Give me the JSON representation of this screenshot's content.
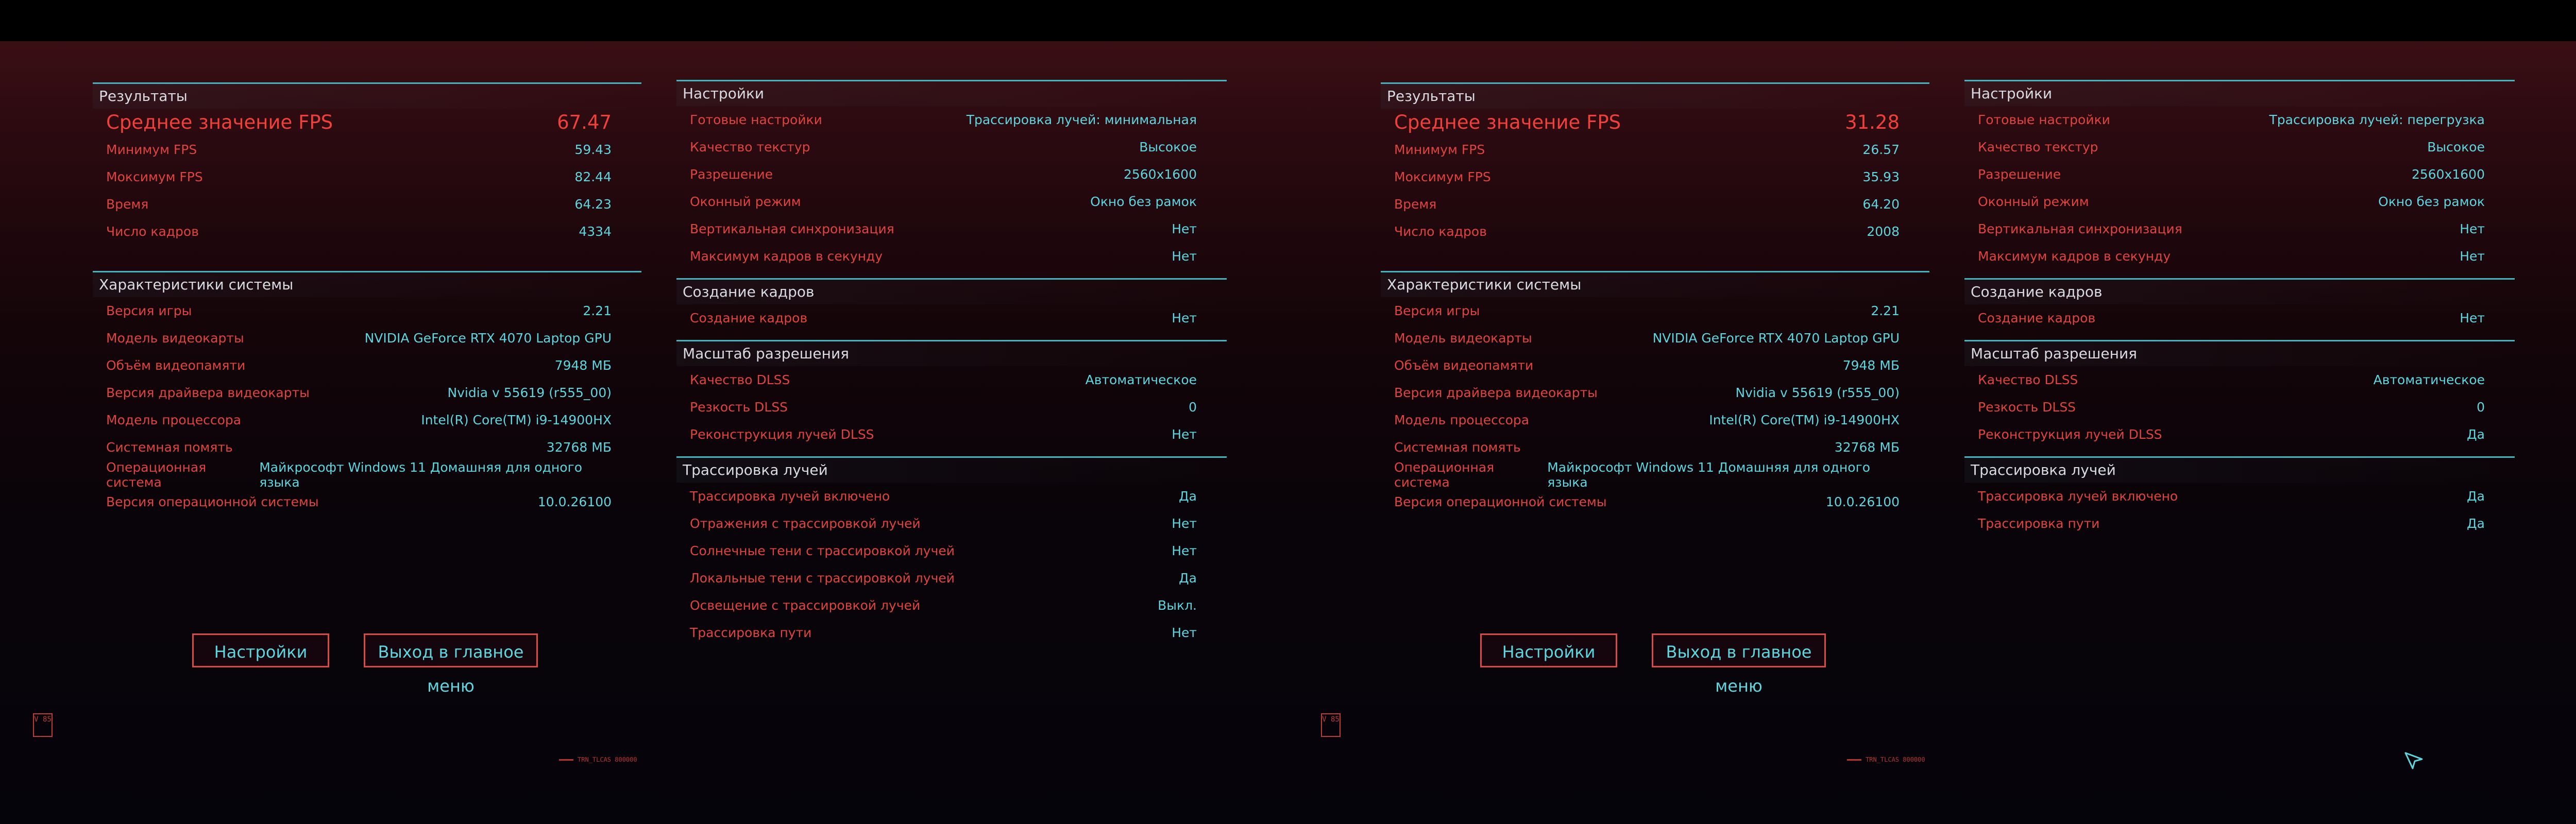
{
  "screens": [
    {
      "results": {
        "title": "Результаты",
        "avg_label": "Среднее значение FPS",
        "avg_value": "67.47",
        "rows": [
          {
            "k": "Минимум FPS",
            "v": "59.43"
          },
          {
            "k": "Моксимум FPS",
            "v": "82.44"
          },
          {
            "k": "Время",
            "v": "64.23"
          },
          {
            "k": "Число кадров",
            "v": "4334"
          }
        ]
      },
      "system": {
        "title": "Характеристики системы",
        "rows": [
          {
            "k": "Версия игры",
            "v": "2.21"
          },
          {
            "k": "Модель видеокарты",
            "v": "NVIDIA GeForce RTX 4070 Laptop GPU"
          },
          {
            "k": "Объём видеопамяти",
            "v": "7948 МБ"
          },
          {
            "k": "Версия драйвера видеокарты",
            "v": "Nvidia v 55619 (r555_00)"
          },
          {
            "k": "Модель процессора",
            "v": "Intel(R) Core(TM) i9-14900HX"
          },
          {
            "k": "Системная помять",
            "v": "32768 МБ"
          },
          {
            "k": "Операционная система",
            "v": "Майкрософт Windows 11 Домашняя для одного языка"
          },
          {
            "k": "Версия операционной системы",
            "v": "10.0.26100"
          }
        ]
      },
      "settings": {
        "title": "Настройки",
        "rows": [
          {
            "k": "Готовые настройки",
            "v": "Трассировка лучей: минимальная"
          },
          {
            "k": "Качество текстур",
            "v": "Высокое"
          },
          {
            "k": "Разрешение",
            "v": "2560x1600"
          },
          {
            "k": "Оконный режим",
            "v": "Окно без рамок"
          },
          {
            "k": "Вертикальная синхронизация",
            "v": "Нет"
          },
          {
            "k": "Максимум кадров в секунду",
            "v": "Нет"
          }
        ]
      },
      "frames": {
        "title": "Создание кадров",
        "rows": [
          {
            "k": "Создание кадров",
            "v": "Нет"
          }
        ]
      },
      "scale": {
        "title": "Масштаб разрешения",
        "rows": [
          {
            "k": "Качество DLSS",
            "v": "Автоматическое"
          },
          {
            "k": "Резкость DLSS",
            "v": "0"
          },
          {
            "k": "Реконструкция лучей DLSS",
            "v": "Нет"
          }
        ]
      },
      "rt": {
        "title": "Трассировка лучей",
        "rows": [
          {
            "k": "Трассировка лучей включено",
            "v": "Да"
          },
          {
            "k": "Отражения с трассировкой лучей",
            "v": "Нет"
          },
          {
            "k": "Солнечные тени с трассировкой лучей",
            "v": "Нет"
          },
          {
            "k": "Локальные тени с трассировкой лучей",
            "v": "Да"
          },
          {
            "k": "Освещение с трассировкой лучей",
            "v": "Выкл."
          },
          {
            "k": "Трассировка пути",
            "v": "Нет"
          }
        ]
      },
      "buttons": {
        "settings": "Настройки",
        "exit": "Выход в главное меню"
      }
    },
    {
      "results": {
        "title": "Результаты",
        "avg_label": "Среднее значение FPS",
        "avg_value": "31.28",
        "rows": [
          {
            "k": "Минимум FPS",
            "v": "26.57"
          },
          {
            "k": "Моксимум FPS",
            "v": "35.93"
          },
          {
            "k": "Время",
            "v": "64.20"
          },
          {
            "k": "Число кадров",
            "v": "2008"
          }
        ]
      },
      "system": {
        "title": "Характеристики системы",
        "rows": [
          {
            "k": "Версия игры",
            "v": "2.21"
          },
          {
            "k": "Модель видеокарты",
            "v": "NVIDIA GeForce RTX 4070 Laptop GPU"
          },
          {
            "k": "Объём видеопамяти",
            "v": "7948 МБ"
          },
          {
            "k": "Версия драйвера видеокарты",
            "v": "Nvidia v 55619 (r555_00)"
          },
          {
            "k": "Модель процессора",
            "v": "Intel(R) Core(TM) i9-14900HX"
          },
          {
            "k": "Системная помять",
            "v": "32768 МБ"
          },
          {
            "k": "Операционная система",
            "v": "Майкрософт Windows 11 Домашняя для одного языка"
          },
          {
            "k": "Версия операционной системы",
            "v": "10.0.26100"
          }
        ]
      },
      "settings": {
        "title": "Настройки",
        "rows": [
          {
            "k": "Готовые настройки",
            "v": "Трассировка лучей: перегрузка"
          },
          {
            "k": "Качество текстур",
            "v": "Высокое"
          },
          {
            "k": "Разрешение",
            "v": "2560x1600"
          },
          {
            "k": "Оконный режим",
            "v": "Окно без рамок"
          },
          {
            "k": "Вертикальная синхронизация",
            "v": "Нет"
          },
          {
            "k": "Максимум кадров в секунду",
            "v": "Нет"
          }
        ]
      },
      "frames": {
        "title": "Создание кадров",
        "rows": [
          {
            "k": "Создание кадров",
            "v": "Нет"
          }
        ]
      },
      "scale": {
        "title": "Масштаб разрешения",
        "rows": [
          {
            "k": "Качество DLSS",
            "v": "Автоматическое"
          },
          {
            "k": "Резкость DLSS",
            "v": "0"
          },
          {
            "k": "Реконструкция лучей DLSS",
            "v": "Да"
          }
        ]
      },
      "rt": {
        "title": "Трассировка лучей",
        "rows": [
          {
            "k": "Трассировка лучей включено",
            "v": "Да"
          },
          {
            "k": "Трассировка пути",
            "v": "Да"
          }
        ]
      },
      "buttons": {
        "settings": "Настройки",
        "exit": "Выход в главное меню"
      }
    }
  ],
  "footer": {
    "logo": "V 85",
    "tag": "TRN_TLCAS 800000"
  },
  "colors": {
    "accent_red": "#e0443f",
    "accent_cyan": "#5fd5e0",
    "divider": "#43b3bf",
    "panel_text": "#d8dbe2"
  }
}
